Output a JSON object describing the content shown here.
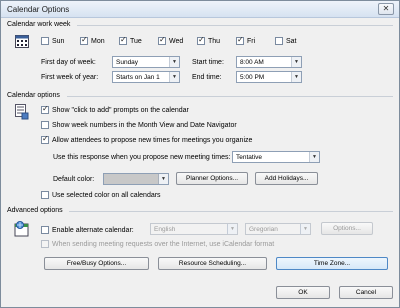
{
  "window": {
    "title": "Calendar Options",
    "close": "✕"
  },
  "work_week": {
    "heading": "Calendar work week",
    "days": [
      {
        "label": "Sun",
        "checked": false
      },
      {
        "label": "Mon",
        "checked": true
      },
      {
        "label": "Tue",
        "checked": true
      },
      {
        "label": "Wed",
        "checked": true
      },
      {
        "label": "Thu",
        "checked": true
      },
      {
        "label": "Fri",
        "checked": true
      },
      {
        "label": "Sat",
        "checked": false
      }
    ],
    "first_day_label": "First day of week:",
    "first_day_value": "Sunday",
    "start_time_label": "Start time:",
    "start_time_value": "8:00 AM",
    "first_week_label": "First week of year:",
    "first_week_value": "Starts on Jan 1",
    "end_time_label": "End time:",
    "end_time_value": "5:00 PM"
  },
  "calendar_options": {
    "heading": "Calendar options",
    "show_click_to_add": "Show \"click to add\" prompts on the calendar",
    "show_week_numbers": "Show week numbers in the Month View and Date Navigator",
    "allow_propose": "Allow attendees to propose new times for meetings you organize",
    "response_label": "Use this response when you propose new meeting times:",
    "response_value": "Tentative",
    "default_color_label": "Default color:",
    "default_color": "#c8c8c8",
    "planner_button": "Planner Options...",
    "holidays_button": "Add Holidays...",
    "use_selected_color": "Use selected color on all calendars"
  },
  "advanced": {
    "heading": "Advanced options",
    "enable_alt_calendar": "Enable alternate calendar:",
    "alt_language": "English",
    "alt_calendar": "Gregorian",
    "options_button": "Options...",
    "icalendar_label": "When sending meeting requests over the Internet, use iCalendar format",
    "freebusy_button": "Free/Busy Options...",
    "resource_button": "Resource Scheduling...",
    "timezone_button": "Time Zone..."
  },
  "footer": {
    "ok": "OK",
    "cancel": "Cancel"
  }
}
